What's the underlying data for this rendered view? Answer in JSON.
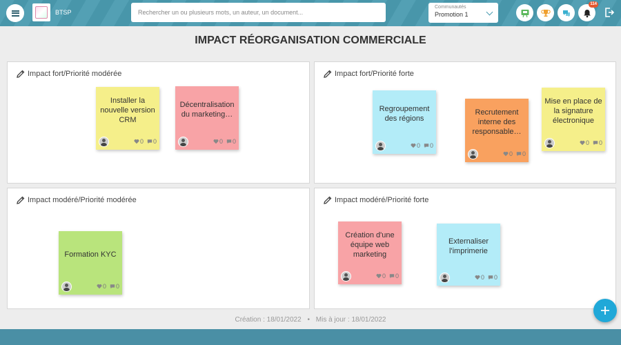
{
  "header": {
    "brand": "BTSP",
    "search_placeholder": "Rechercher un ou plusieurs mots, un auteur, un document...",
    "community_label": "Communautés",
    "community_value": "Promotion 1",
    "notification_count": "114"
  },
  "page": {
    "title": "IMPACT RÉORGANISATION COMMERCIALE"
  },
  "quadrants": [
    {
      "title": "Impact fort/Priorité modérée",
      "notes": [
        {
          "text": "Installer la nouvelle version CRM",
          "color": "#f5ef8a",
          "likes": "0",
          "comments": "0"
        },
        {
          "text": "Décentralisation du marketing…",
          "color": "#f8a3a6",
          "likes": "0",
          "comments": "0"
        }
      ]
    },
    {
      "title": "Impact fort/Priorité forte",
      "notes": [
        {
          "text": "Regroupement des régions",
          "color": "#b3ecf8",
          "likes": "0",
          "comments": "0"
        },
        {
          "text": "Recrutement interne des responsable…",
          "color": "#f9a15f",
          "likes": "0",
          "comments": "0"
        },
        {
          "text": "Mise en place de la signature électronique",
          "color": "#f5ef8a",
          "likes": "0",
          "comments": "0"
        }
      ]
    },
    {
      "title": "Impact modéré/Priorité modérée",
      "notes": [
        {
          "text": "Formation KYC",
          "color": "#b9e47c",
          "likes": "0",
          "comments": "0"
        }
      ]
    },
    {
      "title": "Impact modéré/Priorité forte",
      "notes": [
        {
          "text": "Création d'une équipe web marketing",
          "color": "#f8a3a6",
          "likes": "0",
          "comments": "0"
        },
        {
          "text": "Externaliser l'imprimerie",
          "color": "#b3ecf8",
          "likes": "0",
          "comments": "0"
        }
      ]
    }
  ],
  "footer": {
    "created": "Création : 18/01/2022",
    "separator": "•",
    "updated": "Mis à jour : 18/01/2022"
  },
  "icons": {
    "menu": "menu-icon",
    "whiteboard": "presentation-icon",
    "trophy": "trophy-icon",
    "chat": "chat-icon",
    "bell": "bell-icon",
    "logout": "logout-icon",
    "edit": "pencil-icon",
    "like": "heart-icon",
    "comment": "comment-icon",
    "add": "plus-icon"
  },
  "colors": {
    "accent": "#4a9bb0",
    "fab": "#20a8d8",
    "badge": "#e4572e"
  }
}
